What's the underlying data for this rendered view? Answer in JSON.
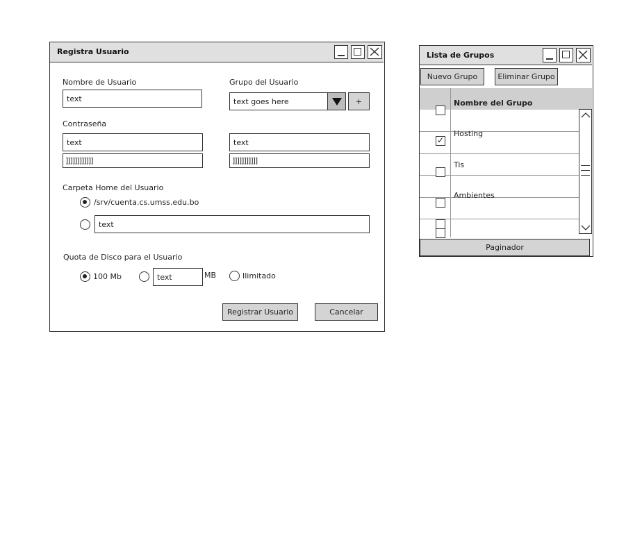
{
  "register_window": {
    "title": "Registra Usuario",
    "username_label": "Nombre de Usuario",
    "username_value": "text",
    "group_label": "Grupo del Usuario",
    "group_value": "text goes here",
    "add_group_label": "+",
    "password_label": "Contraseña",
    "password_value": "text",
    "password_confirm_value": "text",
    "password_strength_1": "]]]]]]]]]]]]",
    "password_strength_2": "]]]]]]]]]]]",
    "home_label": "Carpeta Home del Usuario",
    "home_option_default": "/srv/cuenta.cs.umss.edu.bo",
    "home_option_custom_value": "text",
    "quota_label": "Quota de Disco para el Usuario",
    "quota_option_100": "100 Mb",
    "quota_custom_value": "text",
    "quota_unit": "MB",
    "quota_unlimited": "Ilimitado",
    "register_button": "Registrar Usuario",
    "cancel_button": "Cancelar"
  },
  "groups_window": {
    "title": "Lista de Grupos",
    "new_button": "Nuevo Grupo",
    "delete_button": "Eliminar Grupo",
    "column_header": "Nombre del Grupo",
    "rows": [
      {
        "name": "Hosting",
        "checked": true
      },
      {
        "name": "Tis",
        "checked": false
      },
      {
        "name": "Ambientes",
        "checked": false
      },
      {
        "name": "",
        "checked": false
      }
    ],
    "paginator": "Paginador"
  },
  "icons": {
    "minimize": "minimize-icon",
    "maximize": "maximize-icon",
    "close": "close-icon",
    "dropdown": "triangle-down-icon",
    "scroll_up": "chevron-up-icon",
    "scroll_down": "chevron-down-icon"
  }
}
